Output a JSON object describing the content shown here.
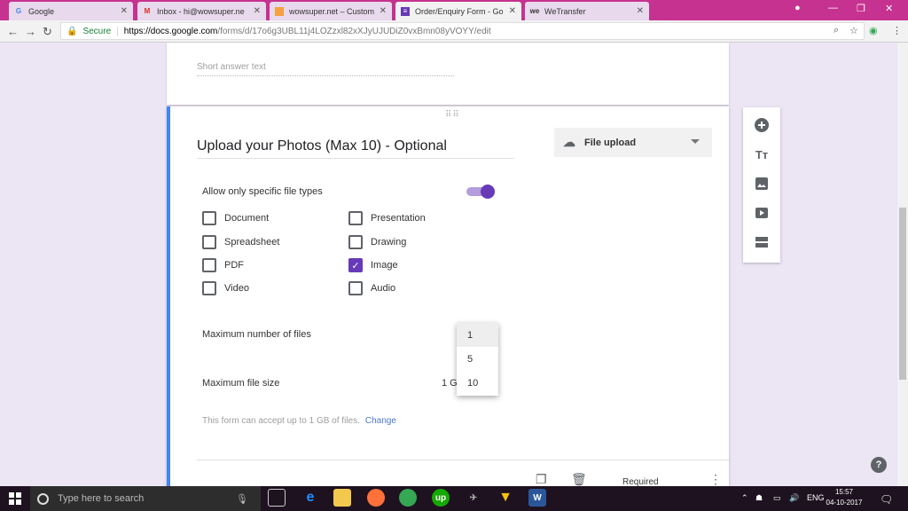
{
  "browser": {
    "tabs": [
      {
        "title": "Google",
        "icon": "google-icon",
        "color": "#4285f4"
      },
      {
        "title": "Inbox - hi@wowsuper.ne",
        "icon": "gmail-icon",
        "color": "#d93025"
      },
      {
        "title": "wowsuper.net – Custom",
        "icon": "site-icon",
        "color": "#f4a142"
      },
      {
        "title": "Order/Enquiry Form - Go",
        "icon": "forms-icon",
        "color": "#673ab7"
      },
      {
        "title": "WeTransfer",
        "icon": "wetransfer-icon",
        "color": "#333333"
      }
    ],
    "secure_label": "Secure",
    "url_host": "https://docs.google.com",
    "url_path": "/forms/d/17o6g3UBL11j4LOZzxl82xXJyUJUDiZ0vxBmn08yVOYY/edit"
  },
  "form": {
    "short_answer_placeholder": "Short answer text",
    "question_title": "Upload your Photos (Max 10) - Optional",
    "question_type": "File upload",
    "allow_specific_label": "Allow only specific file types",
    "allow_specific_on": true,
    "file_types": [
      {
        "label": "Document",
        "checked": false
      },
      {
        "label": "Presentation",
        "checked": false
      },
      {
        "label": "Spreadsheet",
        "checked": false
      },
      {
        "label": "Drawing",
        "checked": false
      },
      {
        "label": "PDF",
        "checked": false
      },
      {
        "label": "Image",
        "checked": true
      },
      {
        "label": "Video",
        "checked": false
      },
      {
        "label": "Audio",
        "checked": false
      }
    ],
    "max_files_label": "Maximum number of files",
    "max_files_options": [
      "1",
      "5",
      "10"
    ],
    "max_files_selected": "1",
    "max_size_label": "Maximum file size",
    "max_size_value": "1 G",
    "storage_note": "This form can accept up to 1 GB of files.",
    "change_link": "Change",
    "required_label": "Required"
  },
  "taskbar": {
    "search_placeholder": "Type here to search",
    "lang": "ENG",
    "time": "15:57",
    "date": "04-10-2017"
  }
}
